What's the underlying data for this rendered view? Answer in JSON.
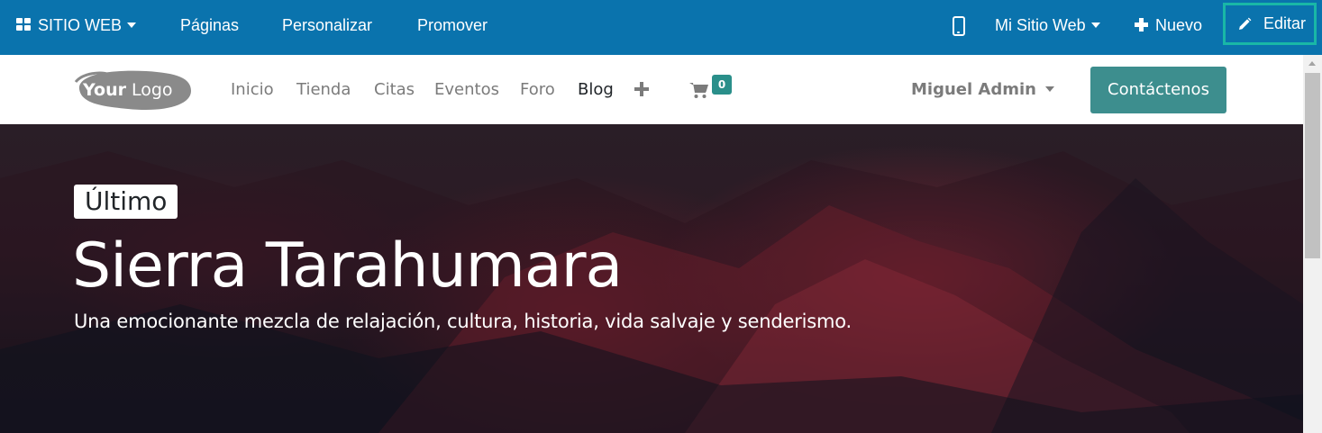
{
  "admin_bar": {
    "apps_label": "SITIO WEB",
    "menu": [
      "Páginas",
      "Personalizar",
      "Promover"
    ],
    "website_selector": "Mi Sitio Web",
    "new_label": "Nuevo",
    "edit_label": "Editar",
    "colors": {
      "background": "#0a73ad",
      "edit_highlight": "#19b7a6"
    }
  },
  "site_nav": {
    "logo": {
      "word1": "Your",
      "word2": "Logo"
    },
    "links": [
      "Inicio",
      "Tienda",
      "Citas",
      "Eventos",
      "Foro",
      "Blog"
    ],
    "active_link": "Blog",
    "cart_count": "0",
    "user_name": "Miguel Admin",
    "contact_button": "Contáctenos",
    "colors": {
      "contact_button": "#3d8e8e",
      "cart_badge": "#2a8f8a"
    }
  },
  "hero": {
    "badge": "Último",
    "title": "Sierra Tarahumara",
    "subtitle": "Una emocionante mezcla de relajación, cultura, historia, vida salvaje y senderismo."
  },
  "icons": [
    "apps-icon",
    "caret-down-icon",
    "phone-icon",
    "plus-icon",
    "pencil-icon",
    "cart-icon"
  ]
}
